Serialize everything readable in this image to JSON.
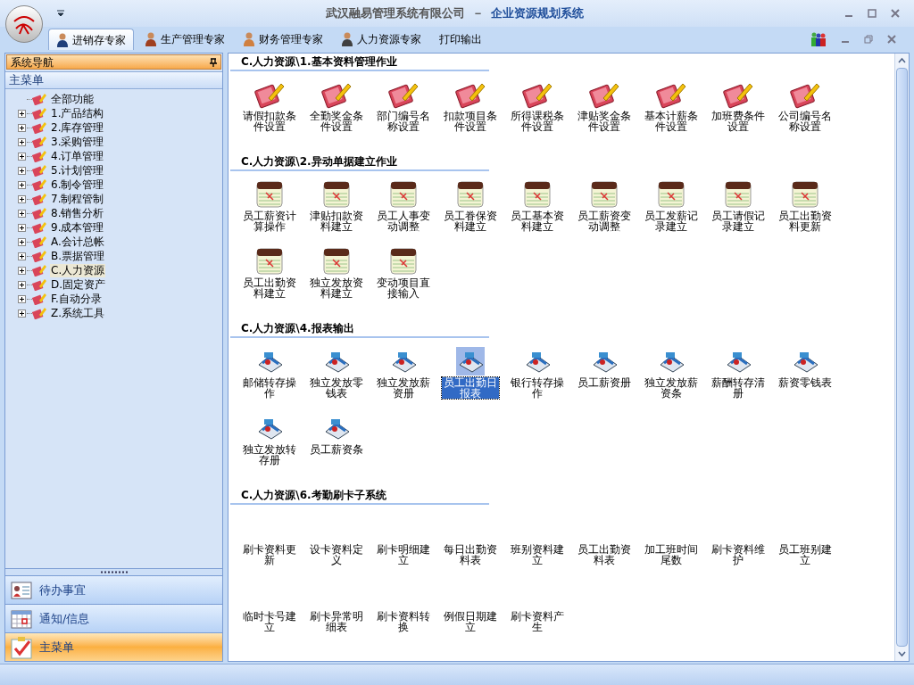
{
  "window": {
    "title_company": "武汉融易管理系统有限公司",
    "title_separator": "－",
    "title_app": "企业资源规划系统"
  },
  "tabs": [
    {
      "label": "进销存专家",
      "selected": true
    },
    {
      "label": "生产管理专家",
      "selected": false
    },
    {
      "label": "财务管理专家",
      "selected": false
    },
    {
      "label": "人力资源专家",
      "selected": false
    },
    {
      "label": "打印输出",
      "selected": false
    }
  ],
  "sidebar": {
    "title": "系统导航",
    "subtitle": "主菜单",
    "tree": [
      {
        "label": "全部功能",
        "kind": "root",
        "selected": false
      },
      {
        "label": "1.产品结构",
        "kind": "group",
        "expanded": false,
        "selected": false
      },
      {
        "label": "2.库存管理",
        "kind": "group",
        "expanded": false,
        "selected": false
      },
      {
        "label": "3.采购管理",
        "kind": "group",
        "expanded": false,
        "selected": false
      },
      {
        "label": "4.订单管理",
        "kind": "group",
        "expanded": false,
        "selected": false
      },
      {
        "label": "5.计划管理",
        "kind": "group",
        "expanded": false,
        "selected": false
      },
      {
        "label": "6.制令管理",
        "kind": "group",
        "expanded": false,
        "selected": false
      },
      {
        "label": "7.制程管制",
        "kind": "group",
        "expanded": false,
        "selected": false
      },
      {
        "label": "8.销售分析",
        "kind": "group",
        "expanded": false,
        "selected": false
      },
      {
        "label": "9.成本管理",
        "kind": "group",
        "expanded": false,
        "selected": false
      },
      {
        "label": "A.会计总帐",
        "kind": "group",
        "expanded": false,
        "selected": false
      },
      {
        "label": "B.票据管理",
        "kind": "group",
        "expanded": false,
        "selected": false
      },
      {
        "label": "C.人力资源",
        "kind": "group",
        "expanded": false,
        "selected": true
      },
      {
        "label": "D.固定资产",
        "kind": "group",
        "expanded": false,
        "selected": false
      },
      {
        "label": "F.自动分录",
        "kind": "group",
        "expanded": false,
        "selected": false
      },
      {
        "label": "Z.系统工具",
        "kind": "group",
        "expanded": false,
        "selected": false
      }
    ],
    "buttons": [
      {
        "label": "待办事宜",
        "kind": "contact",
        "selected": false
      },
      {
        "label": "通知/信息",
        "kind": "calendar",
        "selected": false
      },
      {
        "label": "主菜单",
        "kind": "checklist",
        "selected": true
      }
    ]
  },
  "sections": [
    {
      "title": "C.人力资源\\1.基本资料管理作业",
      "kind": "ledger",
      "items": [
        {
          "label": "请假扣款条件设置",
          "selected": false
        },
        {
          "label": "全勤奖金条件设置",
          "selected": false
        },
        {
          "label": "部门编号名称设置",
          "selected": false
        },
        {
          "label": "扣款项目条件设置",
          "selected": false
        },
        {
          "label": "所得课税条件设置",
          "selected": false
        },
        {
          "label": "津贴奖金条件设置",
          "selected": false
        },
        {
          "label": "基本计薪条件设置",
          "selected": false
        },
        {
          "label": "加班费条件设置",
          "selected": false
        },
        {
          "label": "公司编号名称设置",
          "selected": false
        }
      ]
    },
    {
      "title": "C.人力资源\\2.异动单据建立作业",
      "kind": "notepad",
      "items": [
        {
          "label": "员工薪资计算操作",
          "selected": false
        },
        {
          "label": "津贴扣款资料建立",
          "selected": false
        },
        {
          "label": "员工人事变动调整",
          "selected": false
        },
        {
          "label": "员工眷保资料建立",
          "selected": false
        },
        {
          "label": "员工基本资料建立",
          "selected": false
        },
        {
          "label": "员工薪资变动调整",
          "selected": false
        },
        {
          "label": "员工发薪记录建立",
          "selected": false
        },
        {
          "label": "员工请假记录建立",
          "selected": false
        },
        {
          "label": "员工出勤资料更新",
          "selected": false
        },
        {
          "label": "员工出勤资料建立",
          "selected": false
        },
        {
          "label": "独立发放资料建立",
          "selected": false
        },
        {
          "label": "变动项目直接输入",
          "selected": false
        }
      ]
    },
    {
      "title": "C.人力资源\\4.报表输出",
      "kind": "report",
      "items": [
        {
          "label": "邮储转存操作",
          "selected": false
        },
        {
          "label": "独立发放零钱表",
          "selected": false
        },
        {
          "label": "独立发放薪资册",
          "selected": false
        },
        {
          "label": "员工出勤日报表",
          "selected": true
        },
        {
          "label": "银行转存操作",
          "selected": false
        },
        {
          "label": "员工薪资册",
          "selected": false
        },
        {
          "label": "独立发放薪资条",
          "selected": false
        },
        {
          "label": "薪酬转存清册",
          "selected": false
        },
        {
          "label": "薪资零钱表",
          "selected": false
        },
        {
          "label": "独立发放转存册",
          "selected": false
        },
        {
          "label": "员工薪资条",
          "selected": false
        }
      ]
    },
    {
      "title": "C.人力资源\\6.考勤刷卡子系统",
      "kind": "none",
      "items": [
        {
          "label": "刷卡资料更新",
          "selected": false
        },
        {
          "label": "设卡资料定义",
          "selected": false
        },
        {
          "label": "刷卡明细建立",
          "selected": false
        },
        {
          "label": "每日出勤资料表",
          "selected": false
        },
        {
          "label": "班别资料建立",
          "selected": false
        },
        {
          "label": "员工出勤资料表",
          "selected": false
        },
        {
          "label": "加工班时间尾数",
          "selected": false
        },
        {
          "label": "刷卡资料维护",
          "selected": false
        },
        {
          "label": "员工班别建立",
          "selected": false
        },
        {
          "label": "临时卡号建立",
          "selected": false
        },
        {
          "label": "刷卡异常明细表",
          "selected": false
        },
        {
          "label": "刷卡资料转换",
          "selected": false
        },
        {
          "label": "例假日期建立",
          "selected": false
        },
        {
          "label": "刷卡资料产生",
          "selected": false
        }
      ]
    }
  ]
}
